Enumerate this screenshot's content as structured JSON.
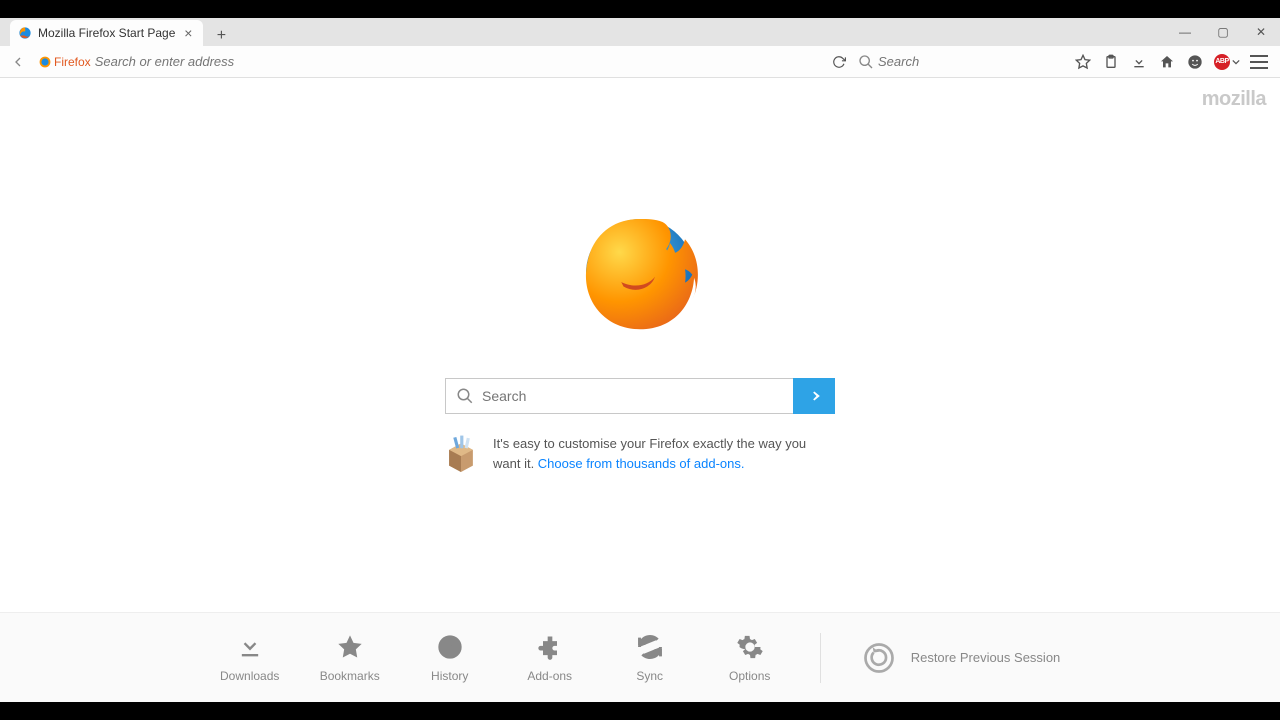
{
  "tab": {
    "title": "Mozilla Firefox Start Page"
  },
  "urlbar": {
    "identity": "Firefox",
    "placeholder": "Search or enter address"
  },
  "toolbar_search": {
    "placeholder": "Search"
  },
  "brand": "mozilla",
  "page_search": {
    "placeholder": "Search"
  },
  "promo": {
    "text": "It's easy to customise your Firefox exactly the way you want it. ",
    "link": "Choose from thousands of add-ons."
  },
  "launchers": [
    {
      "id": "downloads",
      "label": "Downloads"
    },
    {
      "id": "bookmarks",
      "label": "Bookmarks"
    },
    {
      "id": "history",
      "label": "History"
    },
    {
      "id": "addons",
      "label": "Add-ons"
    },
    {
      "id": "sync",
      "label": "Sync"
    },
    {
      "id": "options",
      "label": "Options"
    }
  ],
  "restore": "Restore Previous Session"
}
